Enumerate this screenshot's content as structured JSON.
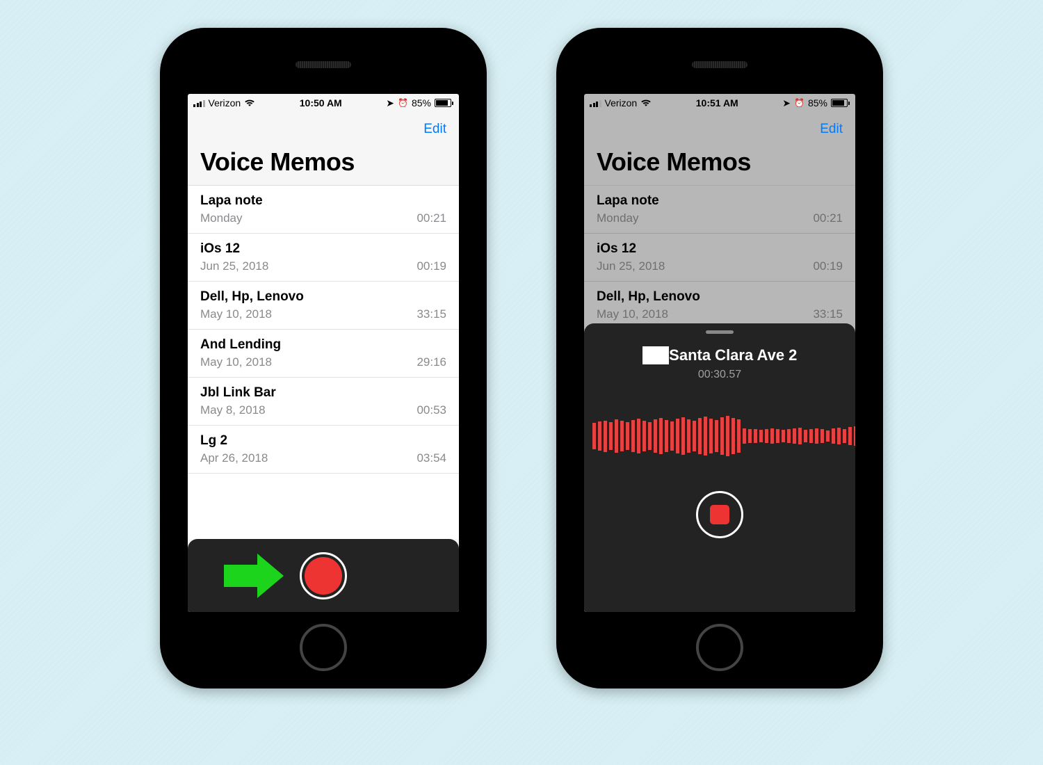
{
  "phone_left": {
    "status": {
      "carrier": "Verizon",
      "time": "10:50 AM",
      "battery_percent": "85%"
    },
    "edit_label": "Edit",
    "app_title": "Voice Memos",
    "memos": [
      {
        "title": "Lapa note",
        "date": "Monday",
        "duration": "00:21"
      },
      {
        "title": "iOs 12",
        "date": "Jun 25, 2018",
        "duration": "00:19"
      },
      {
        "title": "Dell, Hp, Lenovo",
        "date": "May 10, 2018",
        "duration": "33:15"
      },
      {
        "title": "And Lending",
        "date": "May 10, 2018",
        "duration": "29:16"
      },
      {
        "title": "Jbl Link Bar",
        "date": "May 8, 2018",
        "duration": "00:53"
      },
      {
        "title": "Lg 2",
        "date": "Apr 26, 2018",
        "duration": "03:54"
      }
    ]
  },
  "phone_right": {
    "status": {
      "carrier": "Verizon",
      "time": "10:51 AM",
      "battery_percent": "85%"
    },
    "edit_label": "Edit",
    "app_title": "Voice Memos",
    "memos": [
      {
        "title": "Lapa note",
        "date": "Monday",
        "duration": "00:21"
      },
      {
        "title": "iOs 12",
        "date": "Jun 25, 2018",
        "duration": "00:19"
      },
      {
        "title": "Dell, Hp, Lenovo",
        "date": "May 10, 2018",
        "duration": "33:15"
      }
    ],
    "recording": {
      "title_visible": "Santa Clara Ave 2",
      "elapsed": "00:30.57"
    }
  }
}
